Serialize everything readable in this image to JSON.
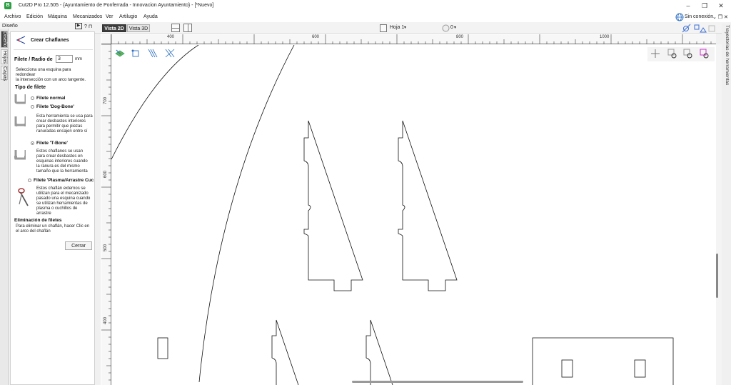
{
  "window": {
    "title": "Cut2D Pro 12.505 - {Ayuntamiento de Ponferrada - Innovacion Ayuntamiento} - [*Nuevo]",
    "logo_letter": "B"
  },
  "menu": [
    "Archivo",
    "Edición",
    "Máquina",
    "Mecanizados",
    "Ver",
    "Artilugio",
    "Ayuda"
  ],
  "connection": {
    "label": "Sin conexión"
  },
  "toolbar": {
    "view_2d": "Vista 2D",
    "view_3d": "Vista 3D",
    "sheet": "Hoja 1",
    "sheet_count": "0"
  },
  "left_header": {
    "label": "Diseño",
    "dock_buttons": "? ⊓"
  },
  "vertical_tabs": [
    "Diseño",
    "Hojas",
    "Capas"
  ],
  "right_tab": "Trayectorias de herramientas",
  "panel": {
    "title": "Crear Chaflanes",
    "radius_label": "Filete / Radio de",
    "radius_value": "3",
    "radius_unit": "mm",
    "intro": [
      "Selecciona una esquina para",
      "redondear",
      " la intersección con un arco tangente."
    ],
    "type_heading": "Tipo de filete",
    "options": [
      {
        "label": "Filete normal",
        "selected": false,
        "desc": []
      },
      {
        "label": "Filete 'Dog-Bone'",
        "selected": false,
        "desc": [
          "Esta herramienta se usa para",
          "crear desbastes interiores",
          "para permitir que piezas",
          "ranuradas encajen entre sí"
        ]
      },
      {
        "label": "Filete 'T-Bone'",
        "selected": true,
        "desc": [
          "Estos chaflanes se usan",
          "para crear desbastes en",
          "esquinas interiores cuando",
          "la ranura es del mismo",
          "tamaño que la herramienta"
        ]
      },
      {
        "label": "Filete 'Plasma/Arrastre Cuc",
        "selected": false,
        "desc": [
          "Estos chaflán externos se",
          "utilizan para el mecanizado",
          "pasado una esquina cuando",
          "se utilizan herramientas de",
          "plasma o cuchillos de",
          "arrastre"
        ]
      }
    ],
    "remove_heading": "Eliminación de filetes",
    "remove_text": [
      "Para eliminar un chaflán, hacer Clic en",
      "el arco del chaflán"
    ],
    "close_button": "Cerrar"
  },
  "ruler": {
    "top_labels": [
      "400",
      "600",
      "800",
      "1000"
    ],
    "left_labels": [
      "700",
      "600",
      "500",
      "400"
    ]
  }
}
